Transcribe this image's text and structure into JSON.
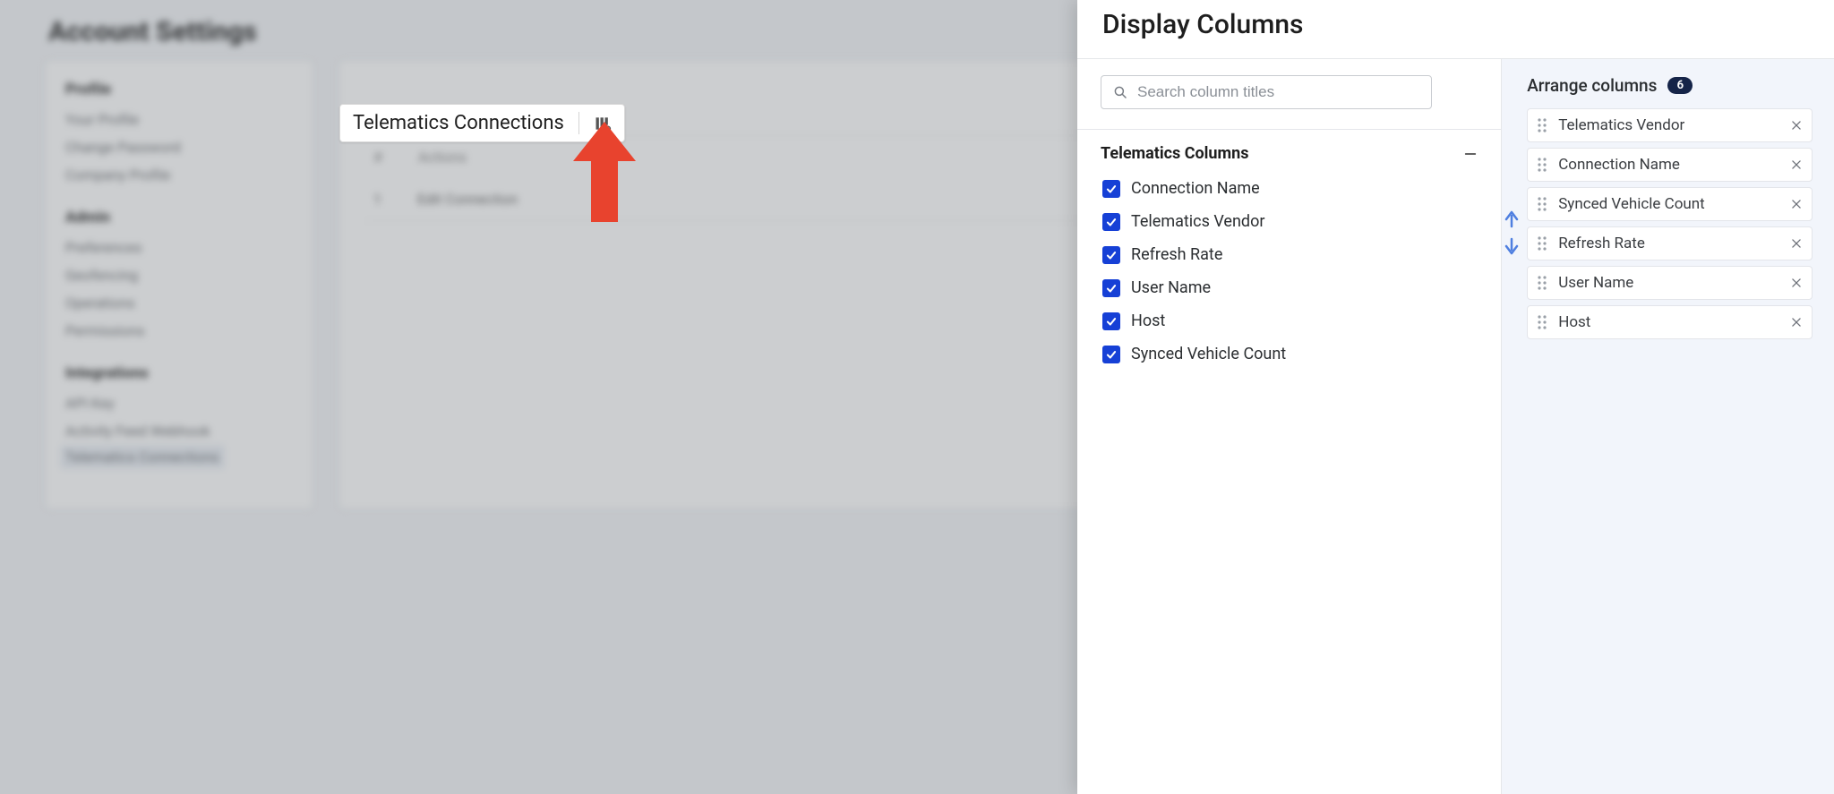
{
  "page_title": "Account Settings",
  "sidebar": {
    "groups": [
      {
        "title": "Profile",
        "items": [
          "Your Profile",
          "Change Password",
          "Company Profile"
        ]
      },
      {
        "title": "Admin",
        "items": [
          "Preferences",
          "Geofencing",
          "Operations",
          "Permissions"
        ]
      },
      {
        "title": "Integrations",
        "items": [
          "API Key",
          "Activity Feed Webhook",
          "Telematics Connections"
        ],
        "active_index": 2
      }
    ]
  },
  "main_header": {
    "title": "Telematics Connections"
  },
  "table_stub": {
    "head": [
      "#",
      "Actions",
      ""
    ],
    "row": [
      "1",
      "Edit Connection",
      ""
    ]
  },
  "drawer": {
    "title": "Display Columns",
    "search_placeholder": "Search column titles",
    "group_title": "Telematics Columns",
    "columns": [
      {
        "label": "Connection Name",
        "checked": true
      },
      {
        "label": "Telematics Vendor",
        "checked": true
      },
      {
        "label": "Refresh Rate",
        "checked": true
      },
      {
        "label": "User Name",
        "checked": true
      },
      {
        "label": "Host",
        "checked": true
      },
      {
        "label": "Synced Vehicle Count",
        "checked": true
      }
    ],
    "arrange_title": "Arrange columns",
    "arrange_count": "6",
    "arrange_items": [
      "Telematics Vendor",
      "Connection Name",
      "Synced Vehicle Count",
      "Refresh Rate",
      "User Name",
      "Host"
    ]
  }
}
